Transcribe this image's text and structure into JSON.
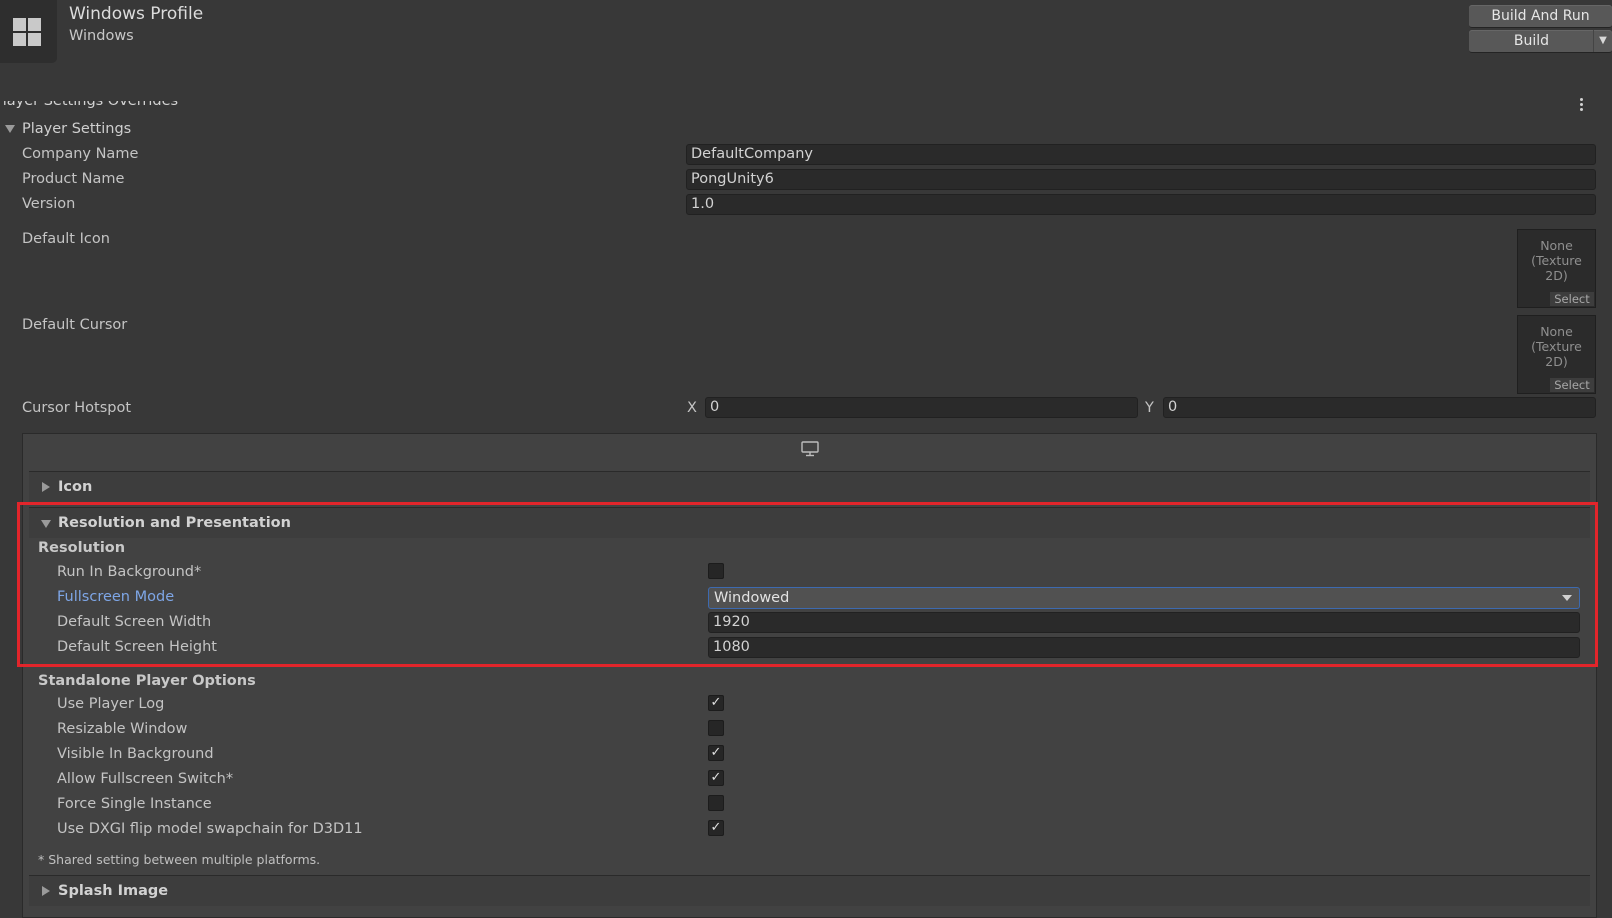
{
  "header": {
    "title": "Windows Profile",
    "subtitle": "Windows",
    "build_and_run": "Build And Run",
    "build": "Build"
  },
  "overrides_label": "Player Settings Overrides",
  "player_settings": {
    "title": "Player Settings",
    "company_name_label": "Company Name",
    "company_name": "DefaultCompany",
    "product_name_label": "Product Name",
    "product_name": "PongUnity6",
    "version_label": "Version",
    "version": "1.0",
    "default_icon_label": "Default Icon",
    "default_cursor_label": "Default Cursor",
    "texture_none": "None",
    "texture_type": "(Texture 2D)",
    "select_label": "Select",
    "cursor_hotspot_label": "Cursor Hotspot",
    "x_label": "X",
    "x_value": "0",
    "y_label": "Y",
    "y_value": "0"
  },
  "sections": {
    "icon": "Icon",
    "resolution_presentation": "Resolution and Presentation",
    "splash_image": "Splash Image"
  },
  "resolution": {
    "heading": "Resolution",
    "run_in_background_label": "Run In Background*",
    "run_in_background": false,
    "fullscreen_mode_label": "Fullscreen Mode",
    "fullscreen_mode": "Windowed",
    "default_width_label": "Default Screen Width",
    "default_width": "1920",
    "default_height_label": "Default Screen Height",
    "default_height": "1080"
  },
  "standalone": {
    "heading": "Standalone Player Options",
    "options": [
      {
        "label": "Use Player Log",
        "checked": true
      },
      {
        "label": "Resizable Window",
        "checked": false
      },
      {
        "label": "Visible In Background",
        "checked": true
      },
      {
        "label": "Allow Fullscreen Switch*",
        "checked": true
      },
      {
        "label": "Force Single Instance",
        "checked": false
      },
      {
        "label": "Use DXGI flip model swapchain for D3D11",
        "checked": true
      }
    ]
  },
  "note": "* Shared setting between multiple platforms.",
  "colors": {
    "background": "#383838",
    "highlight": "#e2252b",
    "link_label": "#7ea6e6",
    "dropdown_border": "#3d6ab0"
  },
  "icons": [
    "windows-logo-icon",
    "kebab-menu-icon",
    "monitor-icon",
    "foldout-arrow-icon",
    "dropdown-arrow-icon",
    "checkmark-icon"
  ]
}
